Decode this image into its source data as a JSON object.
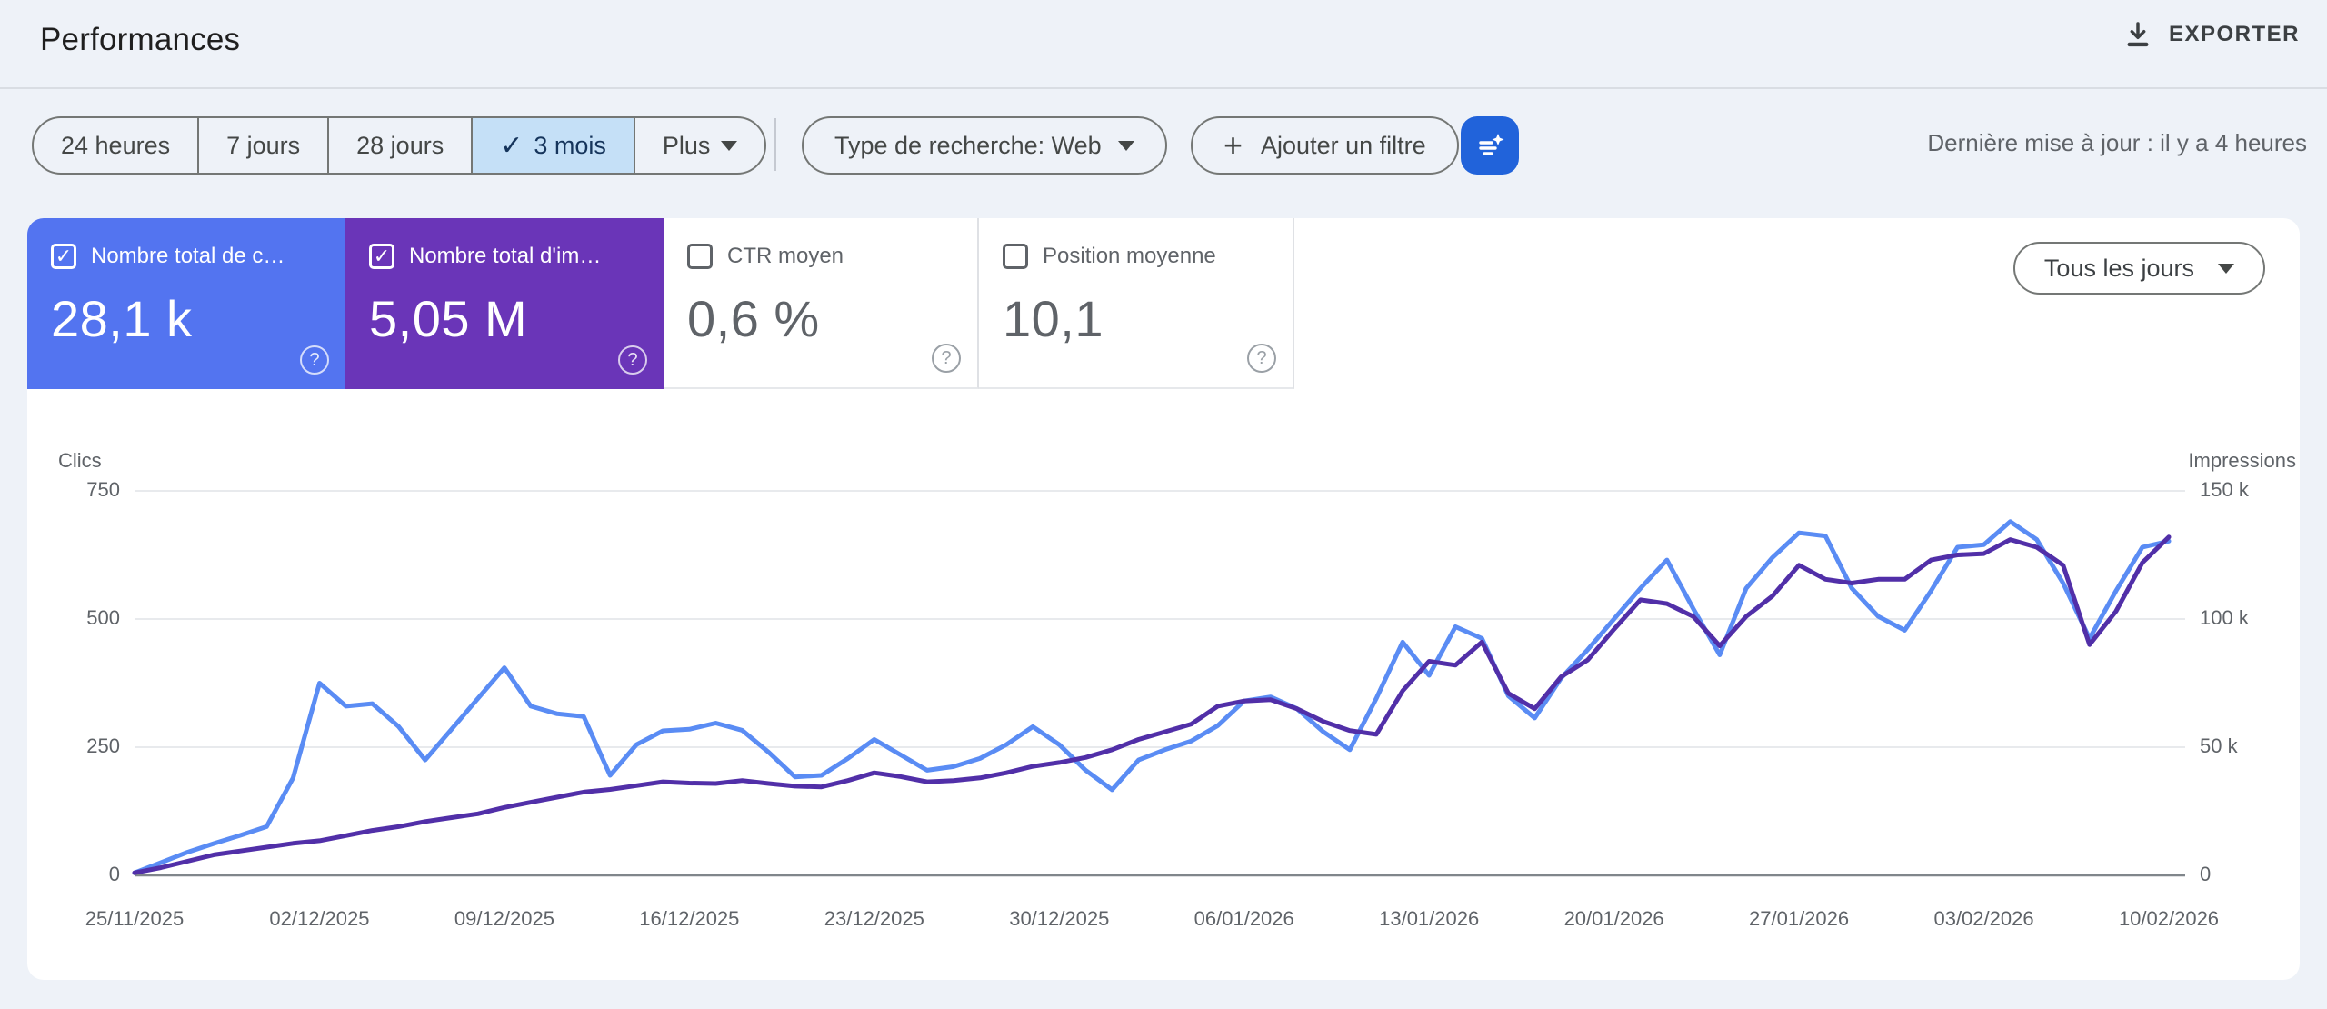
{
  "header": {
    "title": "Performances",
    "export_label": "EXPORTER"
  },
  "toolbar": {
    "date_ranges": [
      {
        "label": "24 heures",
        "selected": false
      },
      {
        "label": "7 jours",
        "selected": false
      },
      {
        "label": "28 jours",
        "selected": false
      },
      {
        "label": "3 mois",
        "selected": true
      },
      {
        "label": "Plus",
        "selected": false,
        "dropdown": true
      }
    ],
    "search_type_label": "Type de recherche: Web",
    "add_filter_label": "Ajouter un filtre",
    "smart_filter_icon": "filter-sparkle-icon",
    "smart_filter_color": "#2163da",
    "last_update": "Dernière mise à jour : il y a 4 heures"
  },
  "metrics": [
    {
      "label": "Nombre total de c…",
      "value": "28,1 k",
      "checked": true,
      "color": "#5374f0"
    },
    {
      "label": "Nombre total d'im…",
      "value": "5,05 M",
      "checked": true,
      "color": "#6a35b8"
    },
    {
      "label": "CTR moyen",
      "value": "0,6 %",
      "checked": false,
      "color": "#ffffff"
    },
    {
      "label": "Position moyenne",
      "value": "10,1",
      "checked": false,
      "color": "#ffffff"
    }
  ],
  "granularity_label": "Tous les jours",
  "chart_data": {
    "type": "line",
    "interval": "daily",
    "x_tick_labels": [
      "25/11/2025",
      "02/12/2025",
      "09/12/2025",
      "16/12/2025",
      "23/12/2025",
      "30/12/2025",
      "06/01/2026",
      "13/01/2026",
      "20/01/2026",
      "27/01/2026",
      "03/02/2026",
      "10/02/2026"
    ],
    "left_axis": {
      "title": "Clics",
      "tick_labels": [
        "0",
        "250",
        "500",
        "750"
      ],
      "tick_values": [
        0,
        250,
        500,
        750
      ],
      "range": [
        0,
        750
      ]
    },
    "right_axis": {
      "title": "Impressions",
      "tick_labels": [
        "0",
        "50 k",
        "100 k",
        "150 k"
      ],
      "tick_values": [
        0,
        50000,
        100000,
        150000
      ],
      "range": [
        0,
        150000
      ]
    },
    "grid": true,
    "legend_position": "none",
    "series": [
      {
        "name": "Clics",
        "axis": "left",
        "color": "#5a8cf4",
        "values": [
          5,
          25,
          45,
          62,
          78,
          95,
          190,
          375,
          330,
          335,
          290,
          225,
          285,
          345,
          405,
          330,
          315,
          310,
          195,
          255,
          282,
          285,
          297,
          283,
          240,
          192,
          195,
          228,
          265,
          235,
          205,
          212,
          228,
          255,
          290,
          255,
          205,
          167,
          225,
          245,
          262,
          292,
          340,
          348,
          325,
          280,
          245,
          345,
          455,
          390,
          485,
          462,
          350,
          307,
          385,
          440,
          500,
          560,
          615,
          520,
          430,
          560,
          620,
          668,
          662,
          560,
          505,
          478,
          555,
          640,
          645,
          690,
          655,
          570,
          462,
          555,
          640,
          652
        ]
      },
      {
        "name": "Impressions",
        "axis": "right",
        "color": "#512fa8",
        "values": [
          1000,
          3000,
          5500,
          8000,
          9500,
          11000,
          12500,
          13500,
          15500,
          17500,
          19000,
          21000,
          22500,
          24000,
          26500,
          28500,
          30500,
          32500,
          33500,
          35000,
          36500,
          36000,
          35800,
          37000,
          35800,
          34800,
          34500,
          37000,
          40000,
          38500,
          36500,
          37000,
          38000,
          40000,
          42500,
          44000,
          46000,
          49000,
          53000,
          56000,
          59000,
          66000,
          68000,
          68500,
          65000,
          60000,
          56500,
          55000,
          72000,
          83500,
          82000,
          91000,
          71000,
          65000,
          77500,
          84000,
          96000,
          107500,
          106000,
          101000,
          89500,
          101000,
          109000,
          121000,
          115500,
          114000,
          115500,
          115500,
          123000,
          125000,
          125500,
          131000,
          128000,
          121000,
          90000,
          103000,
          122000,
          132000
        ]
      }
    ]
  }
}
